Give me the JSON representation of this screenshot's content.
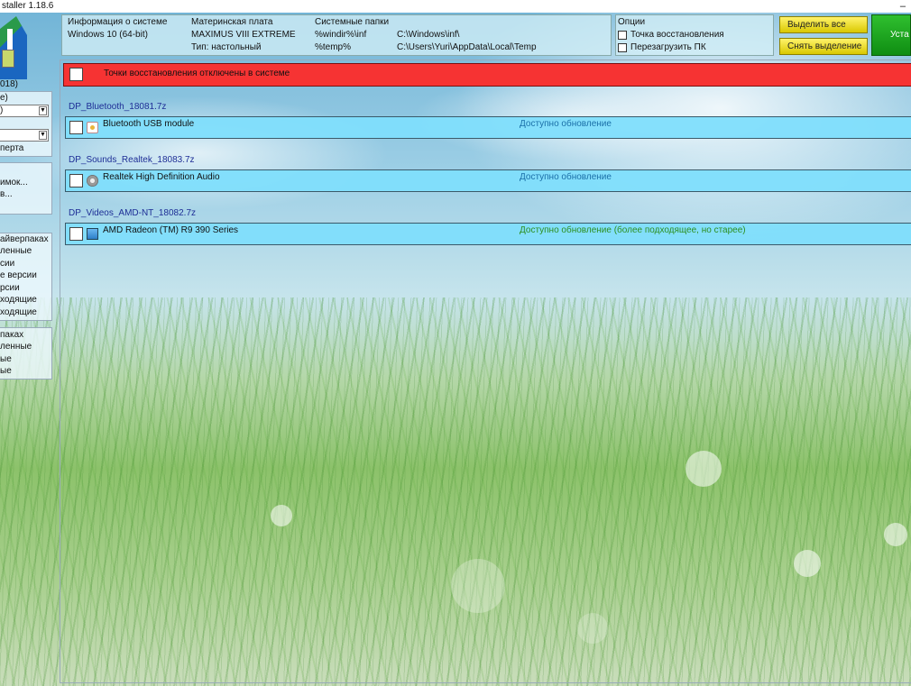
{
  "window": {
    "title": "staller 1.18.6",
    "minimize_glyph": "–"
  },
  "left_panel": {
    "version": "018)",
    "combo1_label": "е)",
    "combo1_value": ")",
    "combo2_value": "",
    "expert_label": "перта",
    "snapshot_items": [
      "имок...",
      "в..."
    ],
    "filters1": [
      "айверпаках",
      "ленные",
      "сии",
      "е версии",
      "рсии",
      "ходящие",
      "ходящие"
    ],
    "filters2": [
      "паках",
      "ленные",
      "ые",
      "ые"
    ]
  },
  "info": {
    "sysinfo_header": "Информация о системе",
    "os": "Windows 10 (64-bit)",
    "motherboard_header": "Материнская плата",
    "motherboard": "MAXIMUS VIII EXTREME",
    "type": "Тип: настольный",
    "folders_header": "Системные папки",
    "folder1_key": "%windir%\\inf",
    "folder1_value": "C:\\Windows\\inf\\",
    "folder2_key": "%temp%",
    "folder2_value": "C:\\Users\\Yuri\\AppData\\Local\\Temp"
  },
  "options": {
    "header": "Опции",
    "restore_point": "Точка восстановления",
    "reboot": "Перезагрузить ПК"
  },
  "buttons": {
    "select_all": "Выделить все",
    "deselect": "Снять выделение",
    "install": "Уста"
  },
  "warning": {
    "text": "Точки восстановления отключены в системе"
  },
  "groups": [
    {
      "pack": "DP_Bluetooth_18081.7z",
      "device": "Bluetooth USB module",
      "status": "Доступно обновление",
      "icon": "bluetooth-device-icon"
    },
    {
      "pack": "DP_Sounds_Realtek_18083.7z",
      "device": "Realtek High Definition Audio",
      "status": "Доступно обновление",
      "icon": "audio-device-icon"
    },
    {
      "pack": "DP_Videos_AMD-NT_18082.7z",
      "device": "AMD Radeon (TM) R9 390 Series",
      "status": "Доступно обновление (более подходящее, но старее)",
      "icon": "display-adapter-icon"
    }
  ],
  "colors": {
    "warning_bg": "#f63333",
    "row_bg": "#80defc",
    "status_blue": "#1a6fa8",
    "status_green": "#2d8f1e",
    "group_title": "#1e2e96"
  }
}
